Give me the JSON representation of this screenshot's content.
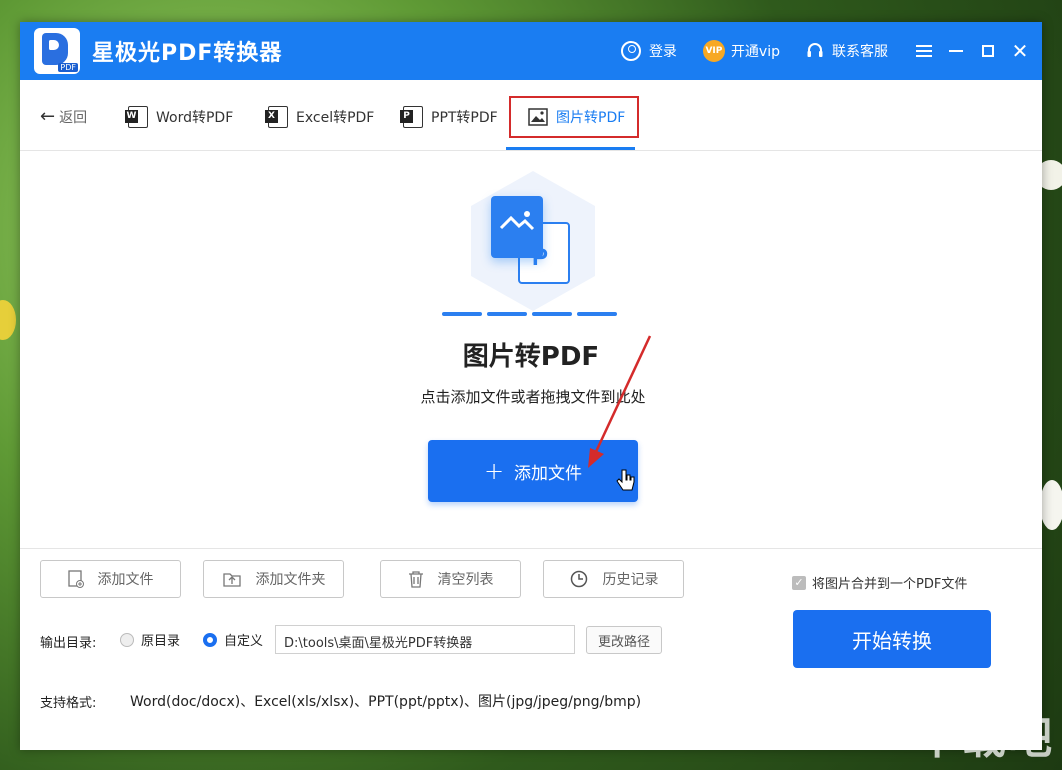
{
  "app": {
    "title": "星极光PDF转换器",
    "logo_tag": "PDF"
  },
  "titlebar": {
    "login": "登录",
    "vip": "开通vip",
    "vip_badge": "VIP",
    "support": "联系客服"
  },
  "tabs": {
    "back": "返回",
    "items": [
      {
        "label": "Word转PDF",
        "badge": "W"
      },
      {
        "label": "Excel转PDF",
        "badge": "X"
      },
      {
        "label": "PPT转PDF",
        "badge": "P"
      },
      {
        "label": "图片转PDF",
        "badge": ""
      }
    ],
    "active_index": 3
  },
  "main": {
    "illustration_letter": "P",
    "title": "图片转PDF",
    "subtitle": "点击添加文件或者拖拽文件到此处",
    "add_button": "添加文件"
  },
  "toolbar": {
    "add_file": "添加文件",
    "add_folder": "添加文件夹",
    "clear_list": "清空列表",
    "history": "历史记录"
  },
  "options": {
    "merge_label": "将图片合并到一个PDF文件",
    "merge_checked": true,
    "output_label": "输出目录:",
    "radio_original": "原目录",
    "radio_custom": "自定义",
    "selected": "custom",
    "path": "D:\\tools\\桌面\\星极光PDF转换器",
    "change_path": "更改路径",
    "start": "开始转换"
  },
  "formats": {
    "label": "支持格式:",
    "text": "Word(doc/docx)、Excel(xls/xlsx)、PPT(ppt/pptx)、图片(jpg/jpeg/png/bmp)"
  },
  "colors": {
    "primary": "#1a7df2",
    "highlight_box": "#d42b2b"
  },
  "watermark": "下载吧"
}
